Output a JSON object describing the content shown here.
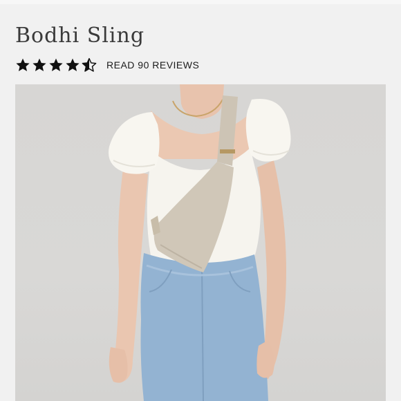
{
  "product": {
    "title": "Bodhi Sling",
    "rating": 4.5,
    "rating_max": 5,
    "reviews_link": "READ 90 REVIEWS"
  },
  "icons": {
    "star_full": "star-icon",
    "star_half": "half-star-icon"
  },
  "colors": {
    "background": "#f1f1f1",
    "text": "#3a3a3a",
    "star": "#111111",
    "photo_bg": "#d8d7d5",
    "bag": "#cfc6b8",
    "top": "#f5f3ec",
    "jeans": "#8fb0cf"
  }
}
